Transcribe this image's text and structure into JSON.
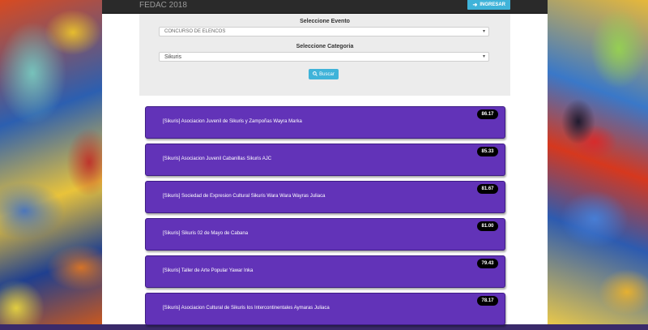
{
  "navbar": {
    "brand": "FEDAC 2018",
    "login_label": "INGRESAR"
  },
  "filters": {
    "event_label": "Seleccione Evento",
    "event_value": "CONCURSO DE ELENCOS",
    "category_label": "Seleccione Categoria",
    "category_value": "Sikuris",
    "search_label": "Buscar"
  },
  "results": [
    {
      "title": "[Sikuris] Asociacion Juvenil de Sikuris y Zampoñas Wayra Marka",
      "score": "86.17"
    },
    {
      "title": "[Sikuris] Asociacion Juvenil Cabanillas Sikuris AJC",
      "score": "85.33"
    },
    {
      "title": "[Sikuris] Sociedad de Expresion Cultural Sikuris Wara Wara Wayras Juliaca",
      "score": "81.67"
    },
    {
      "title": "[Sikuris] Sikuris 02 de Mayo de Cabana",
      "score": "81.00"
    },
    {
      "title": "[Sikuris] Taller de Arte Popular Yawar Inka",
      "score": "79.43"
    },
    {
      "title": "[Sikuris] Asociacion Cultural de Sikuris los Intercontinentales Aymaras Juliaca",
      "score": "78.17"
    }
  ],
  "colors": {
    "card_bg": "#6233b8",
    "accent": "#3fb3d9",
    "navbar": "#2a2a2a"
  },
  "icons": {
    "login": "sign-in-icon",
    "search": "search-icon",
    "dropdown": "chevron-down-icon"
  }
}
